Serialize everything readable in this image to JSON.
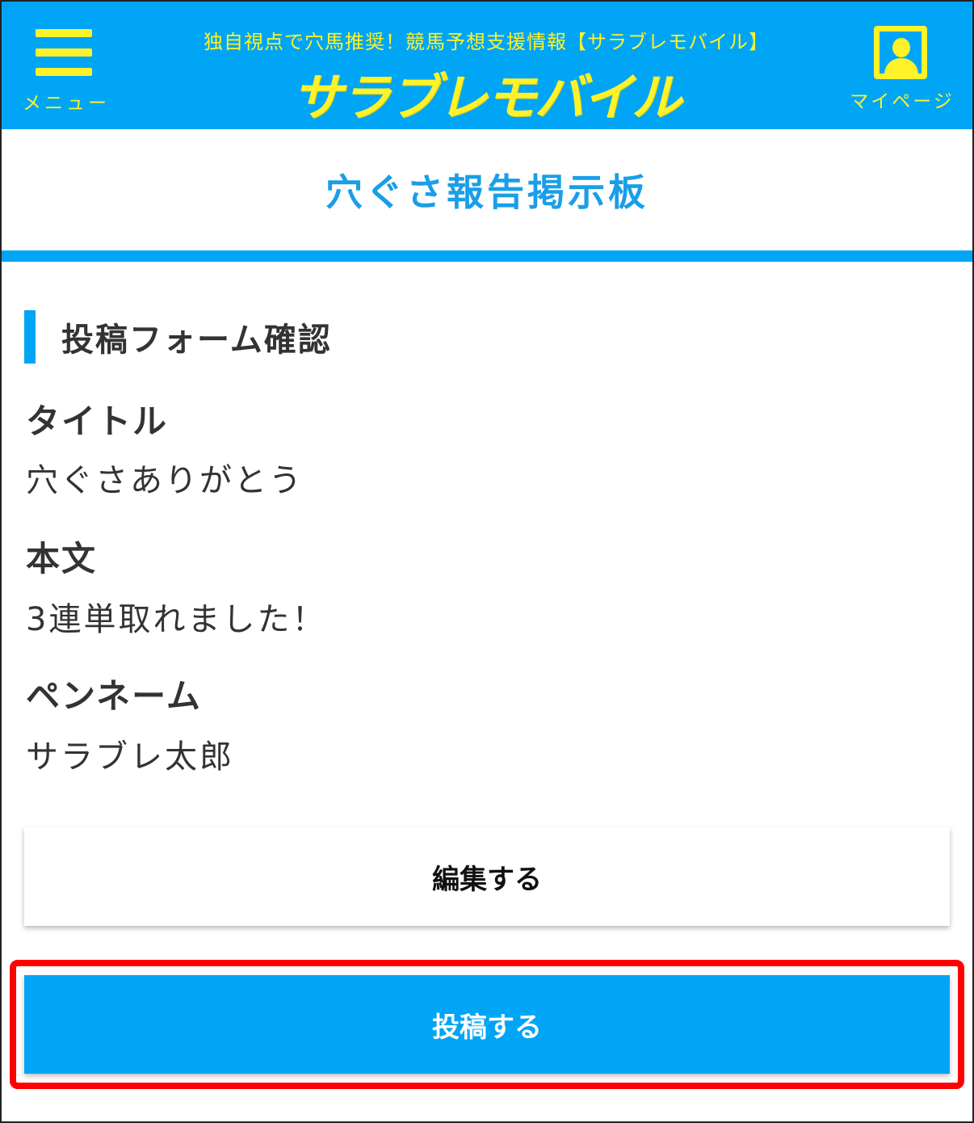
{
  "header": {
    "menu_label": "メニュー",
    "tagline": "独自視点で穴馬推奨！競馬予想支援情報【サラブレモバイル】",
    "logo_text": "サラブレモバイル",
    "mypage_label": "マイページ",
    "menu_icon": "hamburger-menu-icon",
    "mypage_icon": "user-profile-icon",
    "bg_color": "#00a5f5",
    "accent_color": "#fff22a"
  },
  "page": {
    "title": "穴ぐさ報告掲示板",
    "title_color": "#1a9ee8"
  },
  "form": {
    "heading": "投稿フォーム確認",
    "fields": [
      {
        "label": "タイトル",
        "value": "穴ぐさありがとう"
      },
      {
        "label": "本文",
        "value": "3連単取れました！"
      },
      {
        "label": "ペンネーム",
        "value": "サラブレ太郎"
      }
    ]
  },
  "actions": {
    "edit_label": "編集する",
    "submit_label": "投稿する",
    "highlight_color": "#ff0000"
  }
}
